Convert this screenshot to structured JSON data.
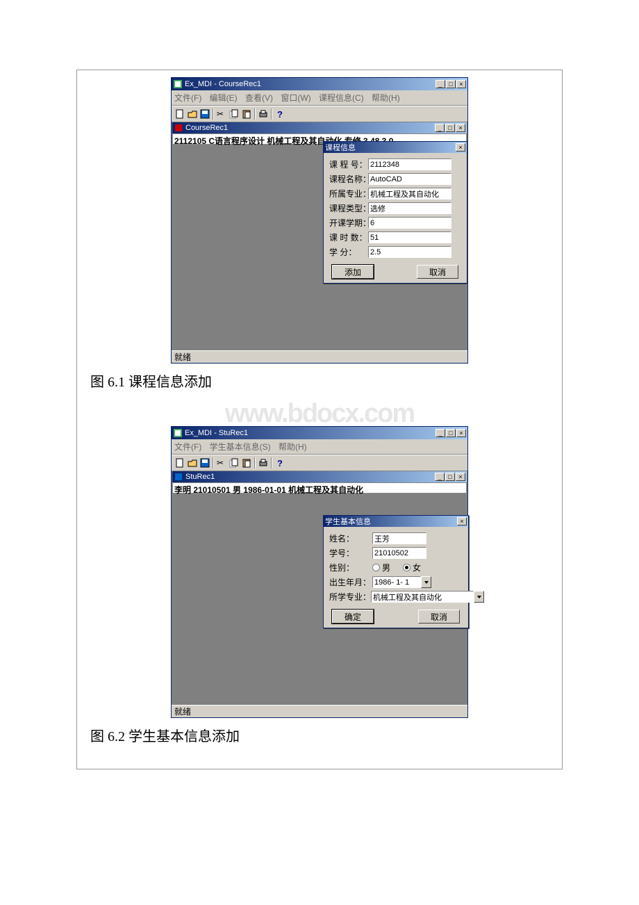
{
  "figure1": {
    "app_title": "Ex_MDI - CourseRec1",
    "menu": {
      "file": "文件(F)",
      "edit": "编辑(E)",
      "view": "查看(V)",
      "window": "窗口(W)",
      "course": "课程信息(C)",
      "help": "帮助(H)"
    },
    "child_title": "CourseRec1",
    "list_text": "2112105  C语言程序设计  机械工程及其自动化  专修  3  48  3.0",
    "dialog_title": "课程信息",
    "fields": {
      "course_no_lbl": "课 程 号：",
      "course_no": "2112348",
      "course_name_lbl": "课程名称：",
      "course_name": "AutoCAD",
      "major_lbl": "所属专业：",
      "major": "机械工程及其自动化",
      "type_lbl": "课程类型：",
      "type": "选修",
      "term_lbl": "开课学期：",
      "term": "6",
      "hours_lbl": "课 时 数：",
      "hours": "51",
      "credit_lbl": "学    分：",
      "credit": "2.5"
    },
    "buttons": {
      "ok": "添加",
      "cancel": "取消"
    },
    "status": "就绪",
    "caption": "图 6.1 课程信息添加"
  },
  "watermark": "www.bdocx.com",
  "figure2": {
    "app_title": "Ex_MDI - StuRec1",
    "menu": {
      "file": "文件(F)",
      "stu": "学生基本信息(S)",
      "help": "帮助(H)"
    },
    "child_title": "StuRec1",
    "list_text": "李明  21010501  男  1986-01-01  机械工程及其自动化",
    "dialog_title": "学生基本信息",
    "fields": {
      "name_lbl": "姓名：",
      "name": "王芳",
      "stu_no_lbl": "学号：",
      "stu_no": "21010502",
      "gender_lbl": "性别：",
      "male": "男",
      "female": "女",
      "birth_lbl": "出生年月：",
      "birth": "1986- 1- 1",
      "major_lbl": "所学专业：",
      "major": "机械工程及其自动化"
    },
    "buttons": {
      "ok": "确定",
      "cancel": "取消"
    },
    "status": "就绪",
    "caption": "图 6.2 学生基本信息添加"
  }
}
